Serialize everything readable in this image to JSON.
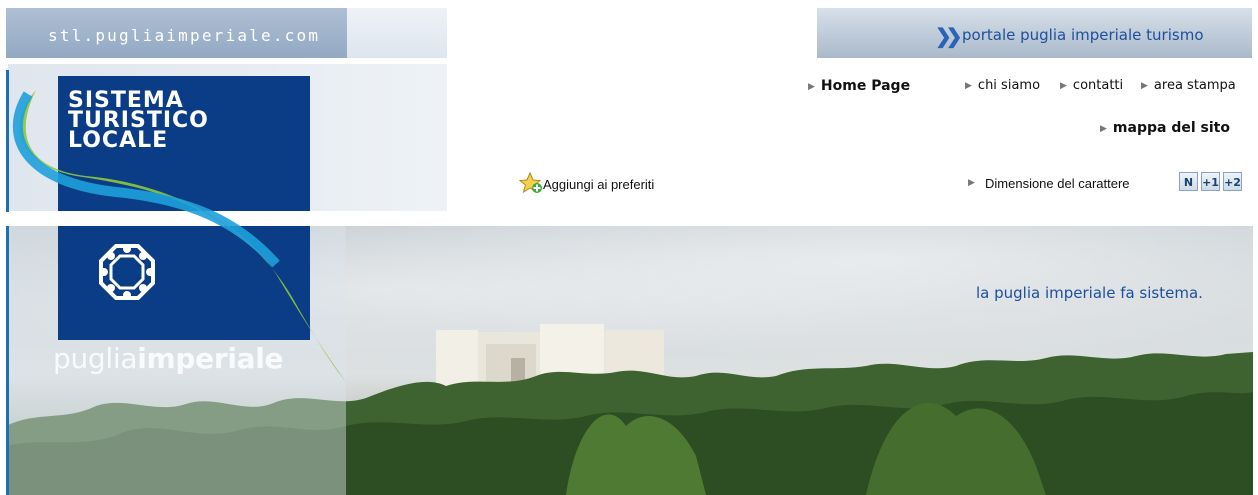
{
  "header": {
    "site_url": "stl.pugliaimperiale.com",
    "portal_link": "portale puglia imperiale turismo",
    "portal_icon": "double-chevron-right-icon"
  },
  "logo": {
    "title_lines": [
      "SISTEMA",
      "TURISTICO",
      "LOCALE"
    ],
    "word_light": "puglia",
    "word_bold": "imperiale",
    "emblem_icon": "octagon-emblem-icon"
  },
  "nav": {
    "items": [
      "Home Page",
      "chi siamo",
      "contatti",
      "area stampa"
    ],
    "sitemap": "mappa del sito"
  },
  "favorites": {
    "label": "Aggiungi ai preferiti",
    "icon": "star-add-icon"
  },
  "font_size": {
    "label": "Dimensione del carattere",
    "buttons": [
      "N",
      "+1",
      "+2"
    ]
  },
  "hero": {
    "tagline": "la puglia imperiale fa sistema."
  },
  "colors": {
    "brand_blue": "#0b3d86",
    "link_blue": "#1d4f9c",
    "accent_green": "#8cc63f",
    "accent_cyan": "#1ea0dc"
  }
}
